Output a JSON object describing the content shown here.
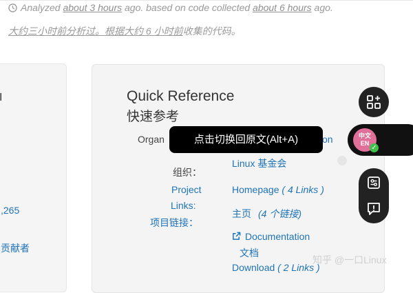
{
  "header": {
    "analyzed_prefix": "Analyzed ",
    "analyzed_time": "about 3 hours",
    "analyzed_mid": " ago. based on code collected ",
    "collected_time": "about 6 hours",
    "analyzed_suffix": " ago.",
    "zh_prefix": "大约三小时前分析过。根据",
    "zh_time": "大约 6 小时前",
    "zh_suffix": "收集的代码。"
  },
  "left_card": {
    "tick": "I",
    "number": ",265",
    "contributors": "贡献者"
  },
  "quick_reference": {
    "title": "Quick Reference",
    "title_zh": "快速参考",
    "org_label": "Organ",
    "org_value_cut": "on",
    "org_label_zh": "组织：",
    "org_value": "Linux 基金会",
    "project_links_line1": "Project",
    "project_links_line2": "Links:",
    "project_links_zh": "项目链接：",
    "homepage": "Homepage",
    "homepage_count": "( 4 Links )",
    "homepage_zh": "主页",
    "homepage_count_zh": "(4 个链接)",
    "documentation": "Documentation",
    "documentation_zh": "文档",
    "download": "Download",
    "download_count": "( 2 Links )"
  },
  "tooltip": {
    "text": "点击切换回原文(Alt+A)"
  },
  "toolbar": {
    "avatar_text_line1": "中文",
    "avatar_text_line2": "EN",
    "icons": [
      "apps-add-icon",
      "translate-avatar-icon",
      "settings-panel-icon",
      "feedback-icon"
    ]
  },
  "watermark": {
    "text": "知乎 @一口Linux"
  },
  "colors": {
    "link": "#1f73b7",
    "muted": "#9a9a9a",
    "card_bg": "#f4f4f4",
    "toolbar_bg": "#222222",
    "tooltip_bg": "#000000",
    "avatar_pink": "#e0709a",
    "check_green": "#3fbf4b"
  }
}
